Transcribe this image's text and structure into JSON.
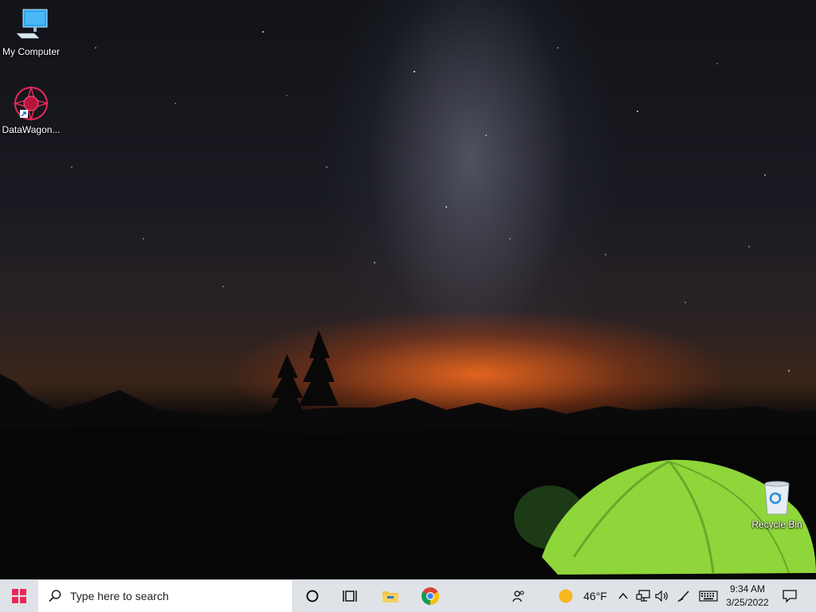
{
  "desktop": {
    "icons": [
      {
        "label": "My Computer",
        "icon": "computer-icon"
      },
      {
        "label": "DataWagon...",
        "icon": "datawagon-app-icon"
      },
      {
        "label": "Recycle Bin",
        "icon": "recycle-bin-icon"
      }
    ]
  },
  "taskbar": {
    "search_placeholder": "Type here to search",
    "pinned": [
      "cortana-icon",
      "task-view-icon",
      "file-explorer-icon",
      "chrome-icon"
    ],
    "weather": {
      "temp": "46°F",
      "icon": "sun-icon"
    },
    "tray": [
      "people-icon",
      "show-hidden-icons-chevron",
      "network-icon",
      "volume-icon",
      "pen-icon",
      "keyboard-icon"
    ],
    "clock": {
      "time": "9:34 AM",
      "date": "3/25/2022"
    },
    "accent": "#e8285a"
  }
}
